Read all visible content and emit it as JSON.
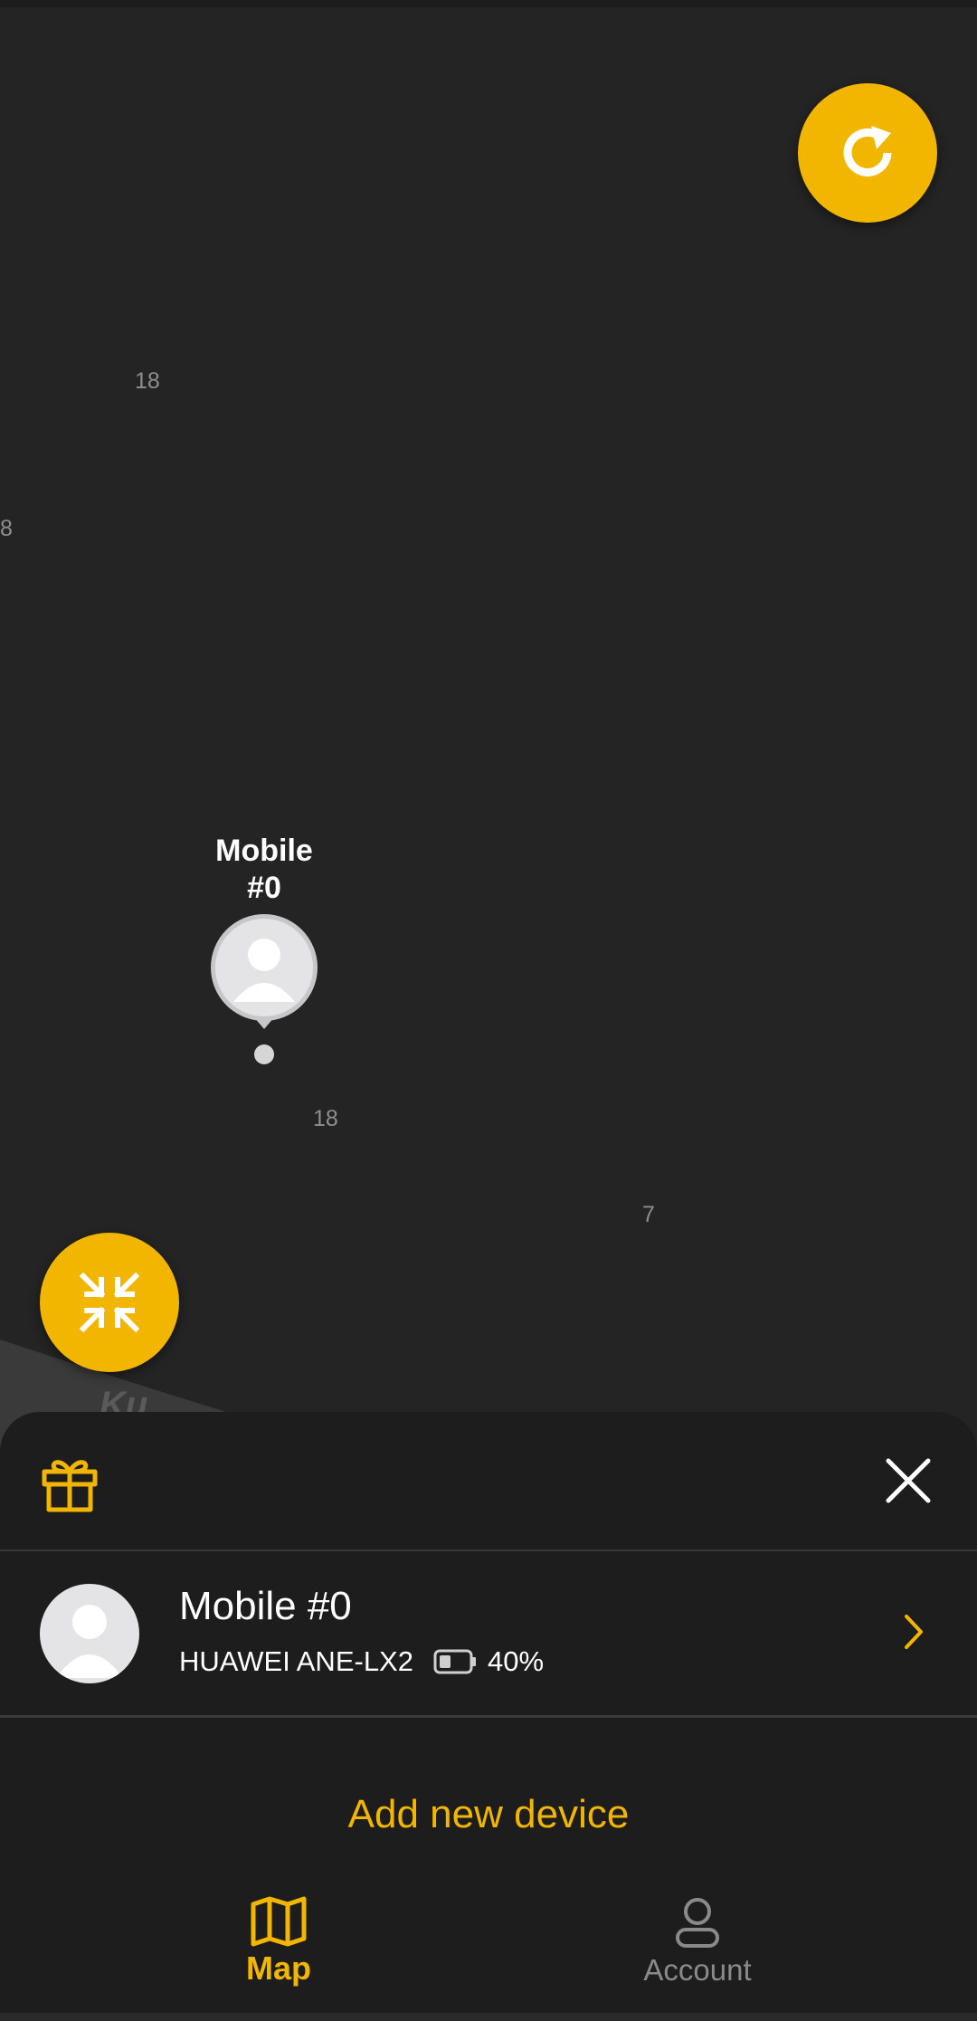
{
  "map": {
    "labels": [
      "18",
      "8",
      "18",
      "7"
    ],
    "fragment": "Kи"
  },
  "marker": {
    "label": "Mobile\n#0"
  },
  "sheet": {
    "device": {
      "name": "Mobile #0",
      "model": "HUAWEI ANE-LX2",
      "battery": "40%",
      "battery_level": 0.4
    },
    "add_device_label": "Add new device"
  },
  "nav": {
    "map_label": "Map",
    "account_label": "Account"
  },
  "colors": {
    "accent": "#f2b600",
    "background": "#232323",
    "sheet": "#1d1d1d"
  }
}
